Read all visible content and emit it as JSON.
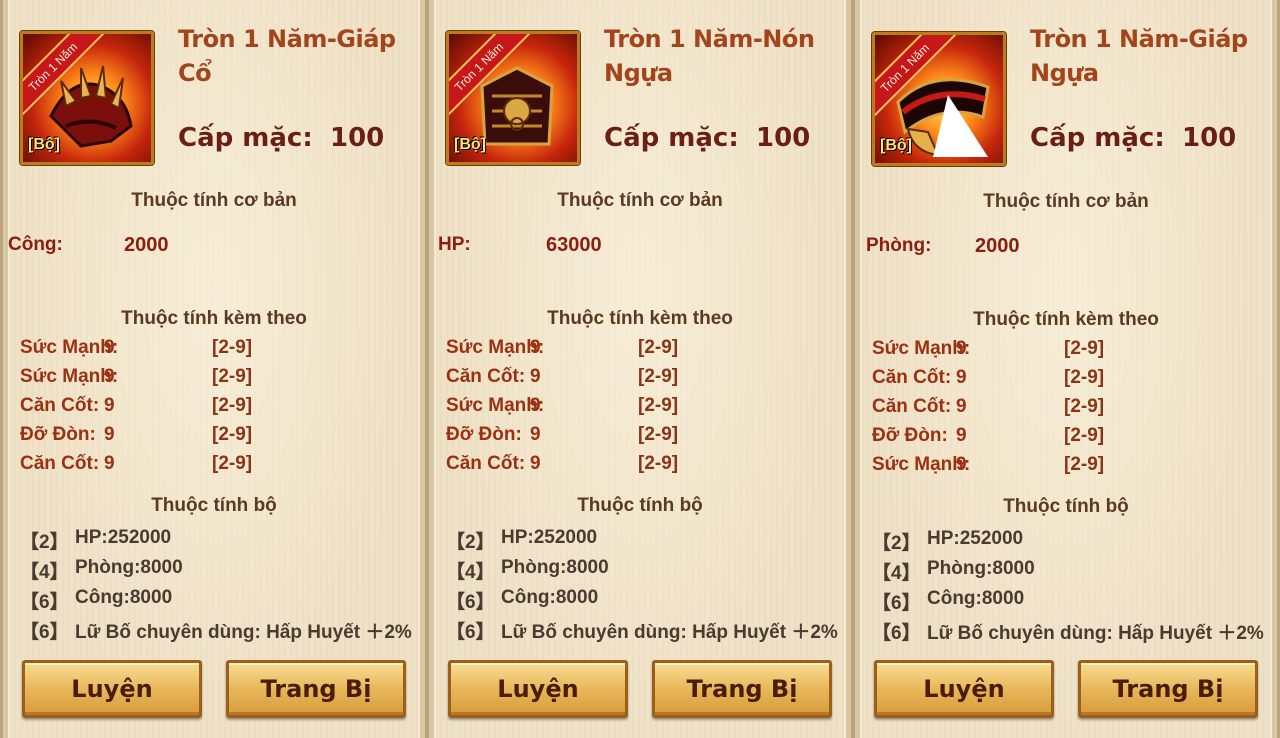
{
  "cards": [
    {
      "title": "Tròn 1 Năm-Giáp Cổ",
      "ribbon": "Tròn 1 Năm",
      "set_tag": "[Bộ]",
      "icon": "armor-neck-icon",
      "req_label": "Cấp mặc:",
      "req_value": "100",
      "base_heading": "Thuộc tính cơ bản",
      "base_label": "Công:",
      "base_value": "2000",
      "extra_heading": "Thuộc tính kèm theo",
      "attrs": [
        {
          "name": "Sức Mạnh:",
          "value": "9",
          "range": "[2-9]"
        },
        {
          "name": "Sức Mạnh:",
          "value": "9",
          "range": "[2-9]"
        },
        {
          "name": "Căn Cốt:",
          "value": "9",
          "range": "[2-9]"
        },
        {
          "name": "Đỡ Đòn:",
          "value": "9",
          "range": "[2-9]"
        },
        {
          "name": "Căn Cốt:",
          "value": "9",
          "range": "[2-9]"
        }
      ],
      "set_heading": "Thuộc tính bộ",
      "set_bonuses": [
        {
          "num": "【2】",
          "text": "HP:252000"
        },
        {
          "num": "【4】",
          "text": "Phòng:8000"
        },
        {
          "num": "【6】",
          "text": "Công:8000"
        },
        {
          "num": "【6】",
          "text": "Lữ Bố chuyên dùng: Hấp Huyết ＋2%"
        }
      ],
      "btn_refine": "Luyện",
      "btn_equip": "Trang Bị"
    },
    {
      "title": "Tròn 1 Năm-Nón Ngựa",
      "ribbon": "Tròn 1 Năm",
      "set_tag": "[Bộ]",
      "icon": "horse-helmet-icon",
      "req_label": "Cấp mặc:",
      "req_value": "100",
      "base_heading": "Thuộc tính cơ bản",
      "base_label": "HP:",
      "base_value": "63000",
      "extra_heading": "Thuộc tính kèm theo",
      "attrs": [
        {
          "name": "Sức Mạnh:",
          "value": "9",
          "range": "[2-9]"
        },
        {
          "name": "Căn Cốt:",
          "value": "9",
          "range": "[2-9]"
        },
        {
          "name": "Sức Mạnh:",
          "value": "9",
          "range": "[2-9]"
        },
        {
          "name": "Đỡ Đòn:",
          "value": "9",
          "range": "[2-9]"
        },
        {
          "name": "Căn Cốt:",
          "value": "9",
          "range": "[2-9]"
        }
      ],
      "set_heading": "Thuộc tính bộ",
      "set_bonuses": [
        {
          "num": "【2】",
          "text": "HP:252000"
        },
        {
          "num": "【4】",
          "text": "Phòng:8000"
        },
        {
          "num": "【6】",
          "text": "Công:8000"
        },
        {
          "num": "【6】",
          "text": "Lữ Bố chuyên dùng: Hấp Huyết ＋2%"
        }
      ],
      "btn_refine": "Luyện",
      "btn_equip": "Trang Bị"
    },
    {
      "title": "Tròn 1 Năm-Giáp Ngựa",
      "ribbon": "Tròn 1 Năm",
      "set_tag": "[Bộ]",
      "icon": "horse-armor-icon",
      "req_label": "Cấp mặc:",
      "req_value": "100",
      "base_heading": "Thuộc tính cơ bản",
      "base_label": "Phòng:",
      "base_value": "2000",
      "extra_heading": "Thuộc tính kèm theo",
      "attrs": [
        {
          "name": "Sức Mạnh:",
          "value": "9",
          "range": "[2-9]"
        },
        {
          "name": "Căn Cốt:",
          "value": "9",
          "range": "[2-9]"
        },
        {
          "name": "Căn Cốt:",
          "value": "9",
          "range": "[2-9]"
        },
        {
          "name": "Đỡ Đòn:",
          "value": "9",
          "range": "[2-9]"
        },
        {
          "name": "Sức Mạnh:",
          "value": "9",
          "range": "[2-9]"
        }
      ],
      "set_heading": "Thuộc tính bộ",
      "set_bonuses": [
        {
          "num": "【2】",
          "text": "HP:252000"
        },
        {
          "num": "【4】",
          "text": "Phòng:8000"
        },
        {
          "num": "【6】",
          "text": "Công:8000"
        },
        {
          "num": "【6】",
          "text": "Lữ Bố chuyên dùng: Hấp Huyết ＋2%"
        }
      ],
      "btn_refine": "Luyện",
      "btn_equip": "Trang Bị"
    }
  ]
}
